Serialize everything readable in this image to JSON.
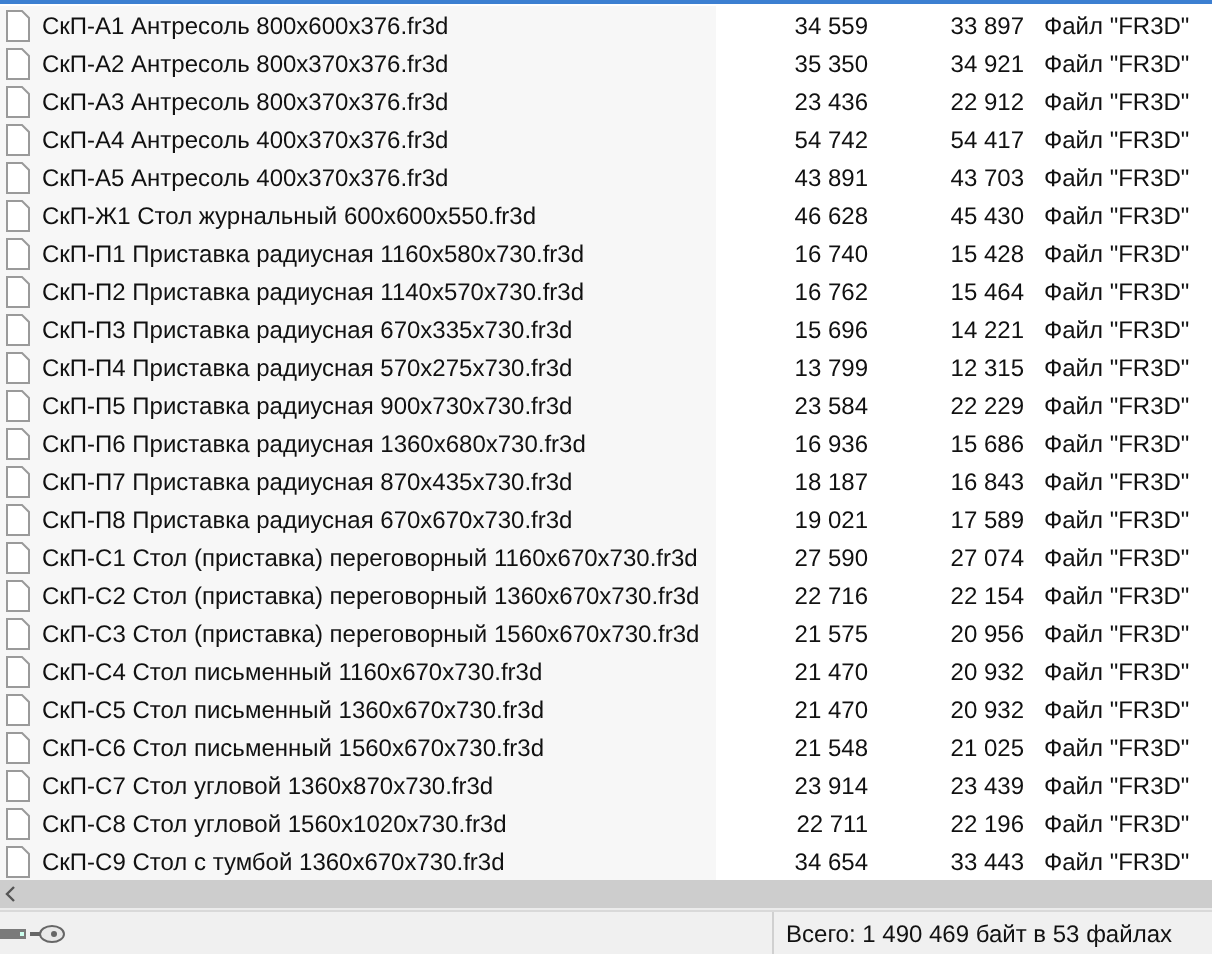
{
  "files": [
    {
      "name": "СкП-А1 Антресоль 800x600x376.fr3d",
      "size": "34 559",
      "packed": "33 897",
      "type": "Файл \"FR3D\""
    },
    {
      "name": "СкП-А2 Антресоль 800x370x376.fr3d",
      "size": "35 350",
      "packed": "34 921",
      "type": "Файл \"FR3D\""
    },
    {
      "name": "СкП-А3 Антресоль 800x370x376.fr3d",
      "size": "23 436",
      "packed": "22 912",
      "type": "Файл \"FR3D\""
    },
    {
      "name": "СкП-А4 Антресоль 400x370x376.fr3d",
      "size": "54 742",
      "packed": "54 417",
      "type": "Файл \"FR3D\""
    },
    {
      "name": "СкП-А5 Антресоль 400x370x376.fr3d",
      "size": "43 891",
      "packed": "43 703",
      "type": "Файл \"FR3D\""
    },
    {
      "name": "СкП-Ж1 Стол журнальный 600x600x550.fr3d",
      "size": "46 628",
      "packed": "45 430",
      "type": "Файл \"FR3D\""
    },
    {
      "name": "СкП-П1 Приставка радиусная 1160x580x730.fr3d",
      "size": "16 740",
      "packed": "15 428",
      "type": "Файл \"FR3D\""
    },
    {
      "name": "СкП-П2 Приставка радиусная 1140x570x730.fr3d",
      "size": "16 762",
      "packed": "15 464",
      "type": "Файл \"FR3D\""
    },
    {
      "name": "СкП-П3 Приставка радиусная 670x335x730.fr3d",
      "size": "15 696",
      "packed": "14 221",
      "type": "Файл \"FR3D\""
    },
    {
      "name": "СкП-П4 Приставка радиусная 570x275x730.fr3d",
      "size": "13 799",
      "packed": "12 315",
      "type": "Файл \"FR3D\""
    },
    {
      "name": "СкП-П5 Приставка радиусная 900x730x730.fr3d",
      "size": "23 584",
      "packed": "22 229",
      "type": "Файл \"FR3D\""
    },
    {
      "name": "СкП-П6 Приставка радиусная 1360x680x730.fr3d",
      "size": "16 936",
      "packed": "15 686",
      "type": "Файл \"FR3D\""
    },
    {
      "name": "СкП-П7 Приставка радиусная 870x435x730.fr3d",
      "size": "18 187",
      "packed": "16 843",
      "type": "Файл \"FR3D\""
    },
    {
      "name": "СкП-П8 Приставка радиусная 670x670x730.fr3d",
      "size": "19 021",
      "packed": "17 589",
      "type": "Файл \"FR3D\""
    },
    {
      "name": "СкП-С1 Стол (приставка) переговорный 1160x670x730.fr3d",
      "size": "27 590",
      "packed": "27 074",
      "type": "Файл \"FR3D\""
    },
    {
      "name": "СкП-С2 Стол (приставка) переговорный 1360x670x730.fr3d",
      "size": "22 716",
      "packed": "22 154",
      "type": "Файл \"FR3D\""
    },
    {
      "name": "СкП-С3 Стол (приставка) переговорный 1560x670x730.fr3d",
      "size": "21 575",
      "packed": "20 956",
      "type": "Файл \"FR3D\""
    },
    {
      "name": "СкП-С4 Стол письменный 1160x670x730.fr3d",
      "size": "21 470",
      "packed": "20 932",
      "type": "Файл \"FR3D\""
    },
    {
      "name": "СкП-С5 Стол письменный 1360x670x730.fr3d",
      "size": "21 470",
      "packed": "20 932",
      "type": "Файл \"FR3D\""
    },
    {
      "name": "СкП-С6 Стол письменный 1560x670x730.fr3d",
      "size": "21 548",
      "packed": "21 025",
      "type": "Файл \"FR3D\""
    },
    {
      "name": "СкП-С7 Стол угловой 1360x870x730.fr3d",
      "size": "23 914",
      "packed": "23 439",
      "type": "Файл \"FR3D\""
    },
    {
      "name": "СкП-С8 Стол угловой 1560x1020x730.fr3d",
      "size": "22 711",
      "packed": "22 196",
      "type": "Файл \"FR3D\""
    },
    {
      "name": "СкП-С9 Стол с тумбой 1360x670x730.fr3d",
      "size": "34 654",
      "packed": "33 443",
      "type": "Файл \"FR3D\""
    }
  ],
  "status": {
    "total": "Всего: 1 490 469 байт в 53 файлах"
  }
}
